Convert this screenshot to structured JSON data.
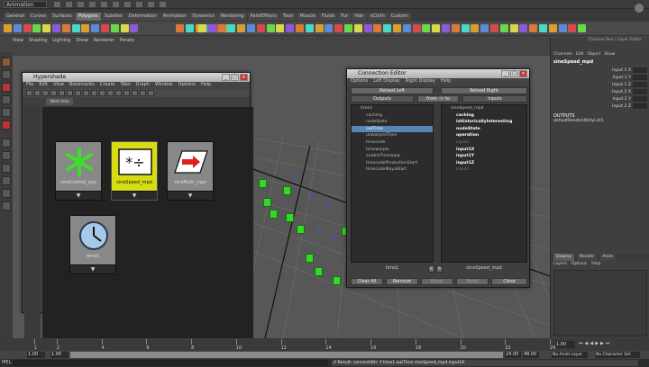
{
  "top": {
    "mode": "Animation"
  },
  "shelf_tabs": [
    "General",
    "Curves",
    "Surfaces",
    "Polygons",
    "Subdivs",
    "Deformation",
    "Animation",
    "Dynamics",
    "Rendering",
    "PaintEffects",
    "Toon",
    "Muscle",
    "Fluids",
    "Fur",
    "Hair",
    "nCloth",
    "Custom"
  ],
  "active_shelf": "Polygons",
  "panel_menu": [
    "View",
    "Shading",
    "Lighting",
    "Show",
    "Renderer",
    "Panels"
  ],
  "hypershade": {
    "title": "Hypershade",
    "menu": [
      "File",
      "Edit",
      "View",
      "Bookmarks",
      "Create",
      "Tabs",
      "Graph",
      "Window",
      "Options",
      "Help"
    ],
    "tab": "Work Area",
    "nodes": [
      {
        "label": "sineControl_exp",
        "bg": "#888888"
      },
      {
        "label": "sineSpeed_mpd",
        "bg": "#d8dc14"
      },
      {
        "label": "sineMulti_mps",
        "bg": "#888888"
      },
      {
        "label": "time1",
        "bg": "#888888"
      }
    ]
  },
  "connection_editor": {
    "title": "Connection Editor",
    "menu": [
      "Options",
      "Left Display",
      "Right Display",
      "Help"
    ],
    "reload_left": "Reload Left",
    "reload_right": "Reload Right",
    "outputs": "Outputs",
    "from_to": "from -> to",
    "inputs": "Inputs",
    "left_items": [
      {
        "text": "time1",
        "cls": ""
      },
      {
        "text": "caching",
        "cls": ""
      },
      {
        "text": "nodeState",
        "cls": ""
      },
      {
        "text": "outTime",
        "cls": "sel"
      },
      {
        "text": "unwarpedTime",
        "cls": ""
      },
      {
        "text": "timecode",
        "cls": ""
      },
      {
        "text": "timewarpIn",
        "cls": ""
      },
      {
        "text": "enableTimewarp",
        "cls": ""
      },
      {
        "text": "timecodeProductionStart",
        "cls": ""
      },
      {
        "text": "timecodeMayaStart",
        "cls": ""
      }
    ],
    "right_items": [
      {
        "text": "sineSpeed_mpd",
        "cls": ""
      },
      {
        "text": "caching",
        "cls": "b"
      },
      {
        "text": "isHistoricallyInteresting",
        "cls": "b"
      },
      {
        "text": "nodeState",
        "cls": "b"
      },
      {
        "text": "operation",
        "cls": "b"
      },
      {
        "text": "input1",
        "cls": "dim"
      },
      {
        "text": "input1X",
        "cls": "b"
      },
      {
        "text": "input1Y",
        "cls": "b"
      },
      {
        "text": "input1Z",
        "cls": "b"
      },
      {
        "text": "input2",
        "cls": "dim"
      }
    ],
    "left_name": "time1",
    "right_name": "sineSpeed_mpd",
    "buttons": [
      "Clear All",
      "Remove",
      "Break",
      "Make",
      "Close"
    ]
  },
  "channel_box": {
    "header": "Channel Box / Layer Editor",
    "menu": [
      "Channels",
      "Edit",
      "Object",
      "Show"
    ],
    "object": "sineSpeed_mpd",
    "channels": [
      "Input 1 X",
      "Input 1 Y",
      "Input 1 Z",
      "Input 2 X",
      "Input 2 Y",
      "Input 2 Z"
    ],
    "outputs_label": "OUTPUTS",
    "output_node": "defaultRenderUtilityList1",
    "layer_tabs": [
      "Display",
      "Render",
      "Anim"
    ],
    "layer_menu": [
      "Layers",
      "Options",
      "Help"
    ]
  },
  "timeline": {
    "ticks": [
      "1",
      "2",
      "4",
      "6",
      "8",
      "10",
      "12",
      "14",
      "16",
      "18",
      "20",
      "22",
      "24"
    ],
    "current": "1.00"
  },
  "range": {
    "start": "1.00",
    "inner_start": "1.00",
    "end": "24.00",
    "end2": "48.00",
    "anim_layer": "No Anim Layer",
    "char_set": "No Character Set"
  },
  "cmdline": {
    "label": "MEL",
    "result": "// Result: connectAttr -f time1.outTime sineSpeed_mpd.input1X"
  },
  "colors": {
    "accent_yellow": "#d8dc14",
    "selection_blue": "#5885b3",
    "green_cube": "#37d62b",
    "blue_marker": "#3a5bd8"
  }
}
